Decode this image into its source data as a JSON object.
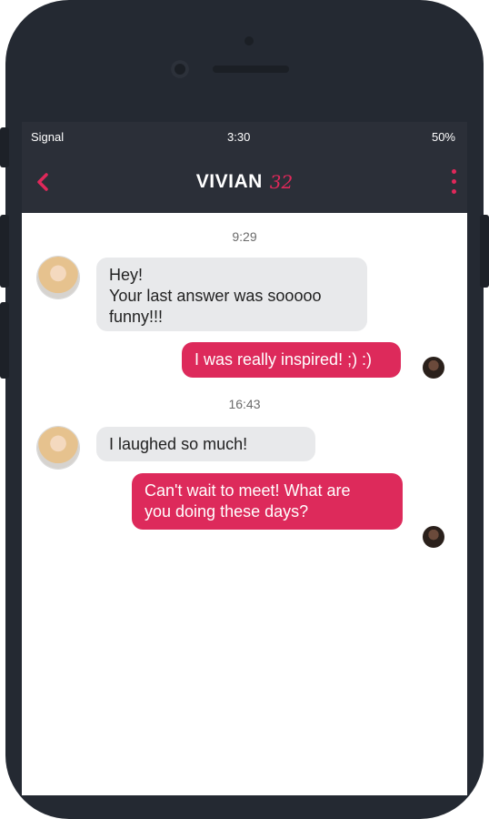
{
  "status": {
    "carrier": "Signal",
    "time": "3:30",
    "battery": "50%"
  },
  "header": {
    "name": "VIVIAN",
    "age": "32"
  },
  "messages": {
    "time1": "9:29",
    "m1_line1": "Hey!",
    "m1_line2": "Your last answer was sooooo",
    "m1_line3": "funny!!!",
    "m2": "I was really inspired! ;) :)",
    "time2": "16:43",
    "m3": "I laughed so much!",
    "m4_line1": "Can't wait to meet! What are",
    "m4_line2": "you doing these days?"
  },
  "colors": {
    "accent": "#dd2a5b",
    "dark": "#2b2f38",
    "incoming_bubble": "#e8e9eb"
  }
}
